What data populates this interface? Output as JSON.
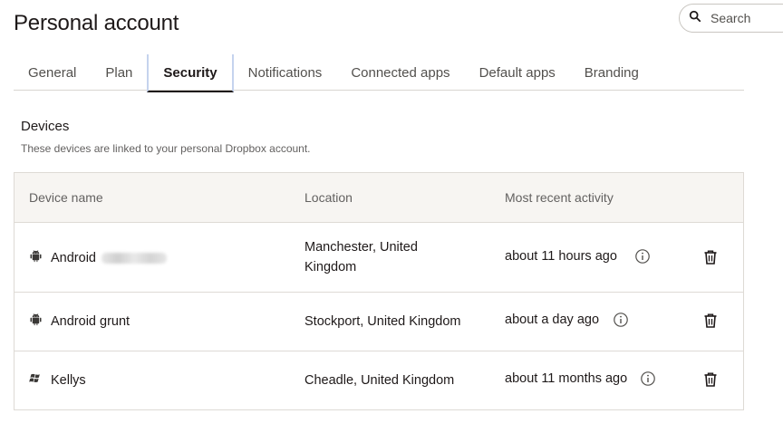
{
  "header": {
    "title": "Personal account"
  },
  "search": {
    "placeholder": "Search"
  },
  "tabs": [
    {
      "label": "General"
    },
    {
      "label": "Plan"
    },
    {
      "label": "Security"
    },
    {
      "label": "Notifications"
    },
    {
      "label": "Connected apps"
    },
    {
      "label": "Default apps"
    },
    {
      "label": "Branding"
    }
  ],
  "active_tab": "Security",
  "devices": {
    "title": "Devices",
    "description": "These devices are linked to your personal Dropbox account.",
    "columns": {
      "name": "Device name",
      "location": "Location",
      "activity": "Most recent activity"
    },
    "rows": [
      {
        "icon": "android-icon",
        "name": "Android",
        "name_redacted": true,
        "location_line1": "Manchester, United",
        "location_line2": "Kingdom",
        "activity": "about 11 hours ago"
      },
      {
        "icon": "android-icon",
        "name": "Android grunt",
        "location_line1": "Stockport, United Kingdom",
        "activity": "about a day ago"
      },
      {
        "icon": "windows-icon",
        "name": "Kellys",
        "location_line1": "Cheadle, United Kingdom",
        "activity": "about 11 months ago"
      }
    ]
  }
}
